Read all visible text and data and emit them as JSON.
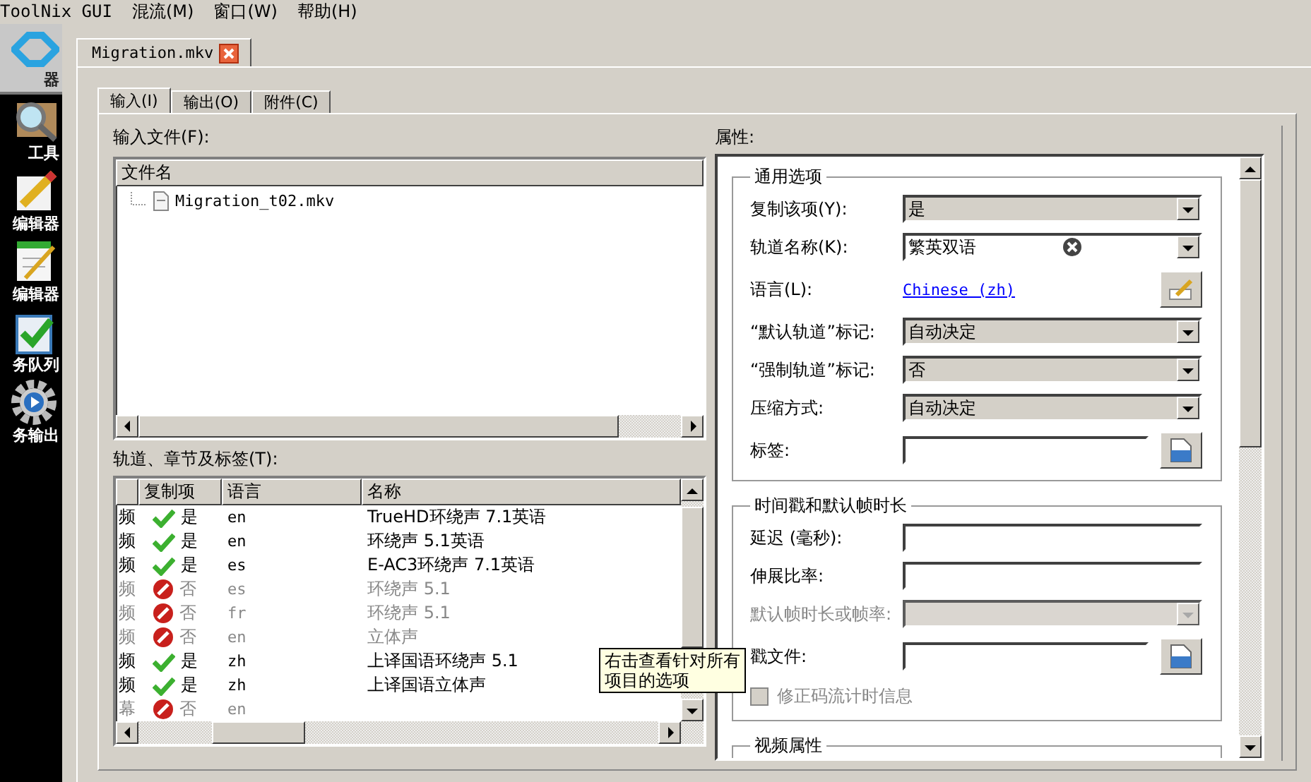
{
  "menu_bar": {
    "app_title": "ToolNix GUI",
    "items": [
      "混流(M)",
      "窗口(W)",
      "帮助(H)"
    ]
  },
  "sidebar": {
    "items": [
      {
        "kind": "merge",
        "label": "器",
        "selected": true
      },
      {
        "kind": "info",
        "label": "工具",
        "selected": false
      },
      {
        "kind": "edit",
        "label": "编辑器",
        "selected": false
      },
      {
        "kind": "notes",
        "label": "编辑器",
        "selected": false
      },
      {
        "kind": "queue",
        "label": "务队列",
        "selected": false
      },
      {
        "kind": "output",
        "label": "务输出",
        "selected": false
      }
    ]
  },
  "document_tabs": [
    {
      "label": "Migration.mkv",
      "selected": true
    }
  ],
  "tabs": [
    {
      "label": "输入(I)",
      "selected": true
    },
    {
      "label": "输出(O)",
      "selected": false
    },
    {
      "label": "附件(C)",
      "selected": false
    }
  ],
  "input_files": {
    "label": "输入文件(F):",
    "column": "文件名",
    "files": [
      "Migration_t02.mkv"
    ]
  },
  "tracks": {
    "label": "轨道、章节及标签(T):",
    "columns": [
      "复制项",
      "语言",
      "名称"
    ],
    "rows": [
      {
        "type": "频",
        "copy": true,
        "copy_label": "是",
        "language": "en",
        "name": "TrueHD环绕声 7.1英语"
      },
      {
        "type": "频",
        "copy": true,
        "copy_label": "是",
        "language": "en",
        "name": "环绕声 5.1英语"
      },
      {
        "type": "频",
        "copy": true,
        "copy_label": "是",
        "language": "es",
        "name": "E-AC3环绕声 7.1英语"
      },
      {
        "type": "频",
        "copy": false,
        "copy_label": "否",
        "language": "es",
        "name": "环绕声 5.1"
      },
      {
        "type": "频",
        "copy": false,
        "copy_label": "否",
        "language": "fr",
        "name": "环绕声 5.1"
      },
      {
        "type": "频",
        "copy": false,
        "copy_label": "否",
        "language": "en",
        "name": "立体声"
      },
      {
        "type": "频",
        "copy": true,
        "copy_label": "是",
        "language": "zh",
        "name": "上译国语环绕声 5.1"
      },
      {
        "type": "频",
        "copy": true,
        "copy_label": "是",
        "language": "zh",
        "name": "上译国语立体声"
      },
      {
        "type": "幕",
        "copy": false,
        "copy_label": "否",
        "language": "en"
      }
    ]
  },
  "tooltip": {
    "lines": [
      "右击查看针对所有",
      "项目的选项"
    ]
  },
  "properties": {
    "label": "属性:",
    "groups": [
      {
        "title": "通用选项",
        "fields": [
          {
            "kind": "select",
            "label": "复制该项(Y):",
            "value": "是",
            "disabled": false
          },
          {
            "kind": "combo",
            "label": "轨道名称(K):",
            "value": "繁英双语",
            "disabled": false
          },
          {
            "kind": "link",
            "label": "语言(L):",
            "value": "Chinese (zh)",
            "disabled": false
          },
          {
            "kind": "select",
            "label": "“默认轨道”标记:",
            "value": "自动决定",
            "disabled": false
          },
          {
            "kind": "select",
            "label": "“强制轨道”标记:",
            "value": "否",
            "disabled": false
          },
          {
            "kind": "select",
            "label": "压缩方式:",
            "value": "自动决定",
            "disabled": false
          },
          {
            "kind": "browse",
            "label": "标签:",
            "disabled": false
          }
        ]
      },
      {
        "title": "时间戳和默认帧时长",
        "fields": [
          {
            "kind": "text",
            "label": "延迟 (毫秒):",
            "disabled": false
          },
          {
            "kind": "text",
            "label": "伸展比率:",
            "disabled": false
          },
          {
            "kind": "select",
            "label": "默认帧时长或帧率:",
            "disabled": true
          },
          {
            "kind": "browse",
            "label": "戳文件:",
            "disabled": false
          },
          {
            "kind": "checkbox",
            "label": "修正码流计时信息",
            "checked": false,
            "disabled": true
          }
        ]
      },
      {
        "title": "视频属性"
      }
    ]
  }
}
